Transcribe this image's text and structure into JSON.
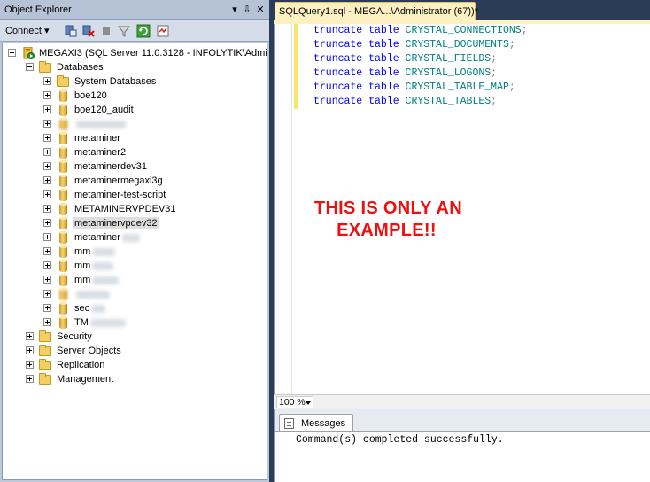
{
  "object_explorer": {
    "title": "Object Explorer",
    "pin_glyph": "⇩",
    "close_glyph": "✕",
    "dropdown_glyph": "▾",
    "connect_label": "Connect",
    "server_node": "MEGAXI3 (SQL Server 11.0.3128 - INFOLYTIK\\Admin",
    "databases_node": "Databases",
    "databases": [
      {
        "label": "System Databases",
        "icon": "folder"
      },
      {
        "label": "boe120",
        "icon": "database"
      },
      {
        "label": "boe120_audit",
        "icon": "database"
      },
      {
        "label": "",
        "icon": "database"
      },
      {
        "label": "metaminer",
        "icon": "database"
      },
      {
        "label": "metaminer2",
        "icon": "database"
      },
      {
        "label": "metaminerdev31",
        "icon": "database"
      },
      {
        "label": "metaminermegaxi3g",
        "icon": "database"
      },
      {
        "label": "metaminer-test-script",
        "icon": "database"
      },
      {
        "label": "METAMINERVPDEV31",
        "icon": "database"
      },
      {
        "label": "metaminervpdev32",
        "icon": "database"
      },
      {
        "label": "metaminer",
        "icon": "database"
      },
      {
        "label": "mm",
        "icon": "database"
      },
      {
        "label": "mm",
        "icon": "database"
      },
      {
        "label": "mm",
        "icon": "database"
      },
      {
        "label": "",
        "icon": "database"
      },
      {
        "label": "sec",
        "icon": "database"
      },
      {
        "label": "TM",
        "icon": "database"
      }
    ],
    "other_nodes": [
      "Security",
      "Server Objects",
      "Replication",
      "Management"
    ]
  },
  "document": {
    "tab_title": "SQLQuery1.sql - MEGA...\\Administrator (67))*",
    "code_lines": [
      {
        "kw1": "truncate",
        "kw2": "table",
        "ident": "CRYSTAL_CONNECTIONS",
        "punct": ";"
      },
      {
        "kw1": "truncate",
        "kw2": "table",
        "ident": "CRYSTAL_DOCUMENTS",
        "punct": ";"
      },
      {
        "kw1": "truncate",
        "kw2": "table",
        "ident": "CRYSTAL_FIELDS",
        "punct": ";"
      },
      {
        "kw1": "truncate",
        "kw2": "table",
        "ident": "CRYSTAL_LOGONS",
        "punct": ";"
      },
      {
        "kw1": "truncate",
        "kw2": "table",
        "ident": "CRYSTAL_TABLE_MAP",
        "punct": ";"
      },
      {
        "kw1": "truncate",
        "kw2": "table",
        "ident": "CRYSTAL_TABLES",
        "punct": ";"
      }
    ],
    "watermark_line1": "THIS IS ONLY AN",
    "watermark_line2": "EXAMPLE!!",
    "zoom_level": "100 %",
    "messages_tab": "Messages",
    "message_text": "Command(s) completed successfully."
  },
  "colors": {
    "keyword": "#0000ff",
    "identifier": "#008080",
    "watermark": "#ee1010",
    "tab_active": "#fdf0c1"
  }
}
